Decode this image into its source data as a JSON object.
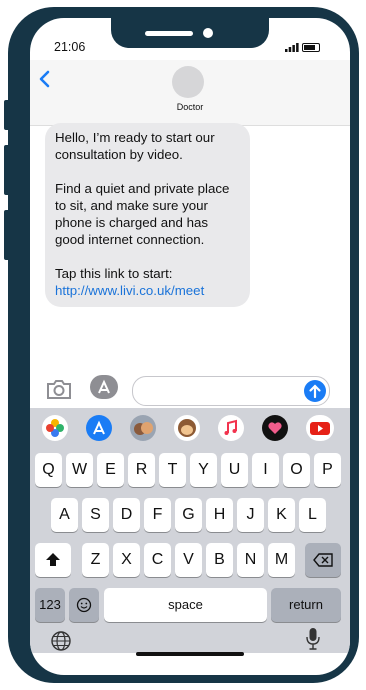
{
  "status_bar": {
    "time": "21:06"
  },
  "header": {
    "contact_name": "Doctor"
  },
  "message": {
    "paragraph1": "Hello, I’m ready to start our consultation by video.",
    "paragraph2": "Find a quiet and private place to sit, and make sure your phone is charged and has good internet connection.",
    "paragraph3": "Tap this link to start:",
    "link": "http://www.livi.co.uk/meet"
  },
  "input": {
    "placeholder": ""
  },
  "keyboard": {
    "row1": [
      "Q",
      "W",
      "E",
      "R",
      "T",
      "Y",
      "U",
      "I",
      "O",
      "P"
    ],
    "row2": [
      "A",
      "S",
      "D",
      "F",
      "G",
      "H",
      "J",
      "K",
      "L"
    ],
    "row3": [
      "Z",
      "X",
      "C",
      "V",
      "B",
      "N",
      "M"
    ],
    "numbers_key": "123",
    "space_key": "space",
    "return_key": "return"
  },
  "colors": {
    "frame": "#163546",
    "accent": "#1a7cf5",
    "link": "#1a73d9",
    "bubble": "#e9e9eb",
    "keyboard_bg": "#d1d3d9"
  },
  "icons": {
    "back": "chevron-left-icon",
    "camera": "camera-icon",
    "apps": "app-store-icon",
    "send": "arrow-up-icon",
    "shift": "shift-icon",
    "delete": "backspace-icon",
    "emoji": "emoji-icon",
    "globe": "globe-icon",
    "mic": "microphone-icon"
  }
}
